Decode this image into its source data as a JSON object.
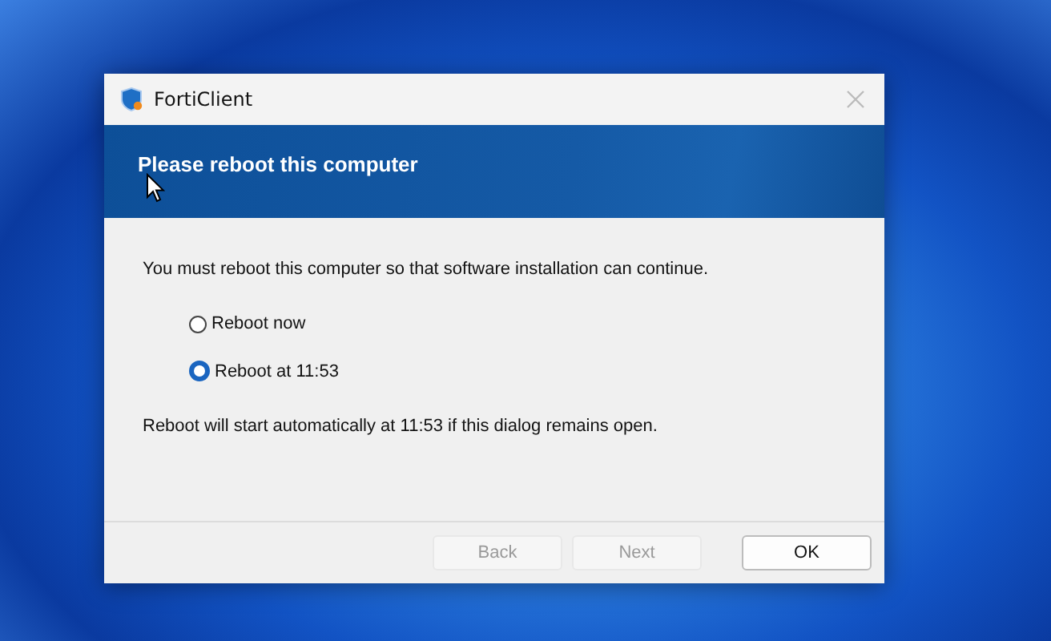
{
  "window": {
    "title": "FortiClient"
  },
  "banner": {
    "heading": "Please reboot this computer"
  },
  "message": "You must reboot this computer so that software installation can continue.",
  "options": [
    {
      "label": "Reboot now",
      "selected": false
    },
    {
      "label": "Reboot at 11:53",
      "selected": true
    }
  ],
  "note": "Reboot will start automatically at 11:53 if this dialog remains open.",
  "buttons": [
    {
      "label": "Back",
      "disabled": true
    },
    {
      "label": "Next",
      "disabled": true
    },
    {
      "label": "OK",
      "disabled": false
    }
  ]
}
